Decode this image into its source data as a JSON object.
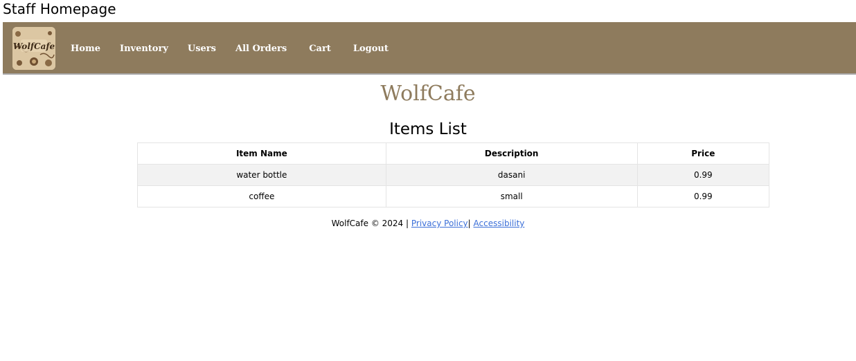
{
  "page": {
    "heading": "Staff Homepage"
  },
  "nav": {
    "logo_icon": "wolfcafe-logo-icon",
    "logo_text": "WolfCafe",
    "background_color": "#8e7b5d",
    "links": [
      {
        "label": "Home"
      },
      {
        "label": "Inventory"
      },
      {
        "label": "Users"
      },
      {
        "label": "All Orders"
      },
      {
        "label": "Cart"
      },
      {
        "label": "Logout"
      }
    ]
  },
  "brand": {
    "title": "WolfCafe",
    "color": "#8e7b5d"
  },
  "items_list": {
    "title": "Items List",
    "columns": [
      "Item Name",
      "Description",
      "Price"
    ],
    "rows": [
      {
        "name": "water bottle",
        "description": "dasani",
        "price": "0.99"
      },
      {
        "name": "coffee",
        "description": "small",
        "price": "0.99"
      }
    ]
  },
  "footer": {
    "copyright": "WolfCafe © 2024 |",
    "privacy_label": "Privacy Policy",
    "separator": "|",
    "accessibility_label": "Accessibility",
    "link_color": "#3b6fd8"
  }
}
